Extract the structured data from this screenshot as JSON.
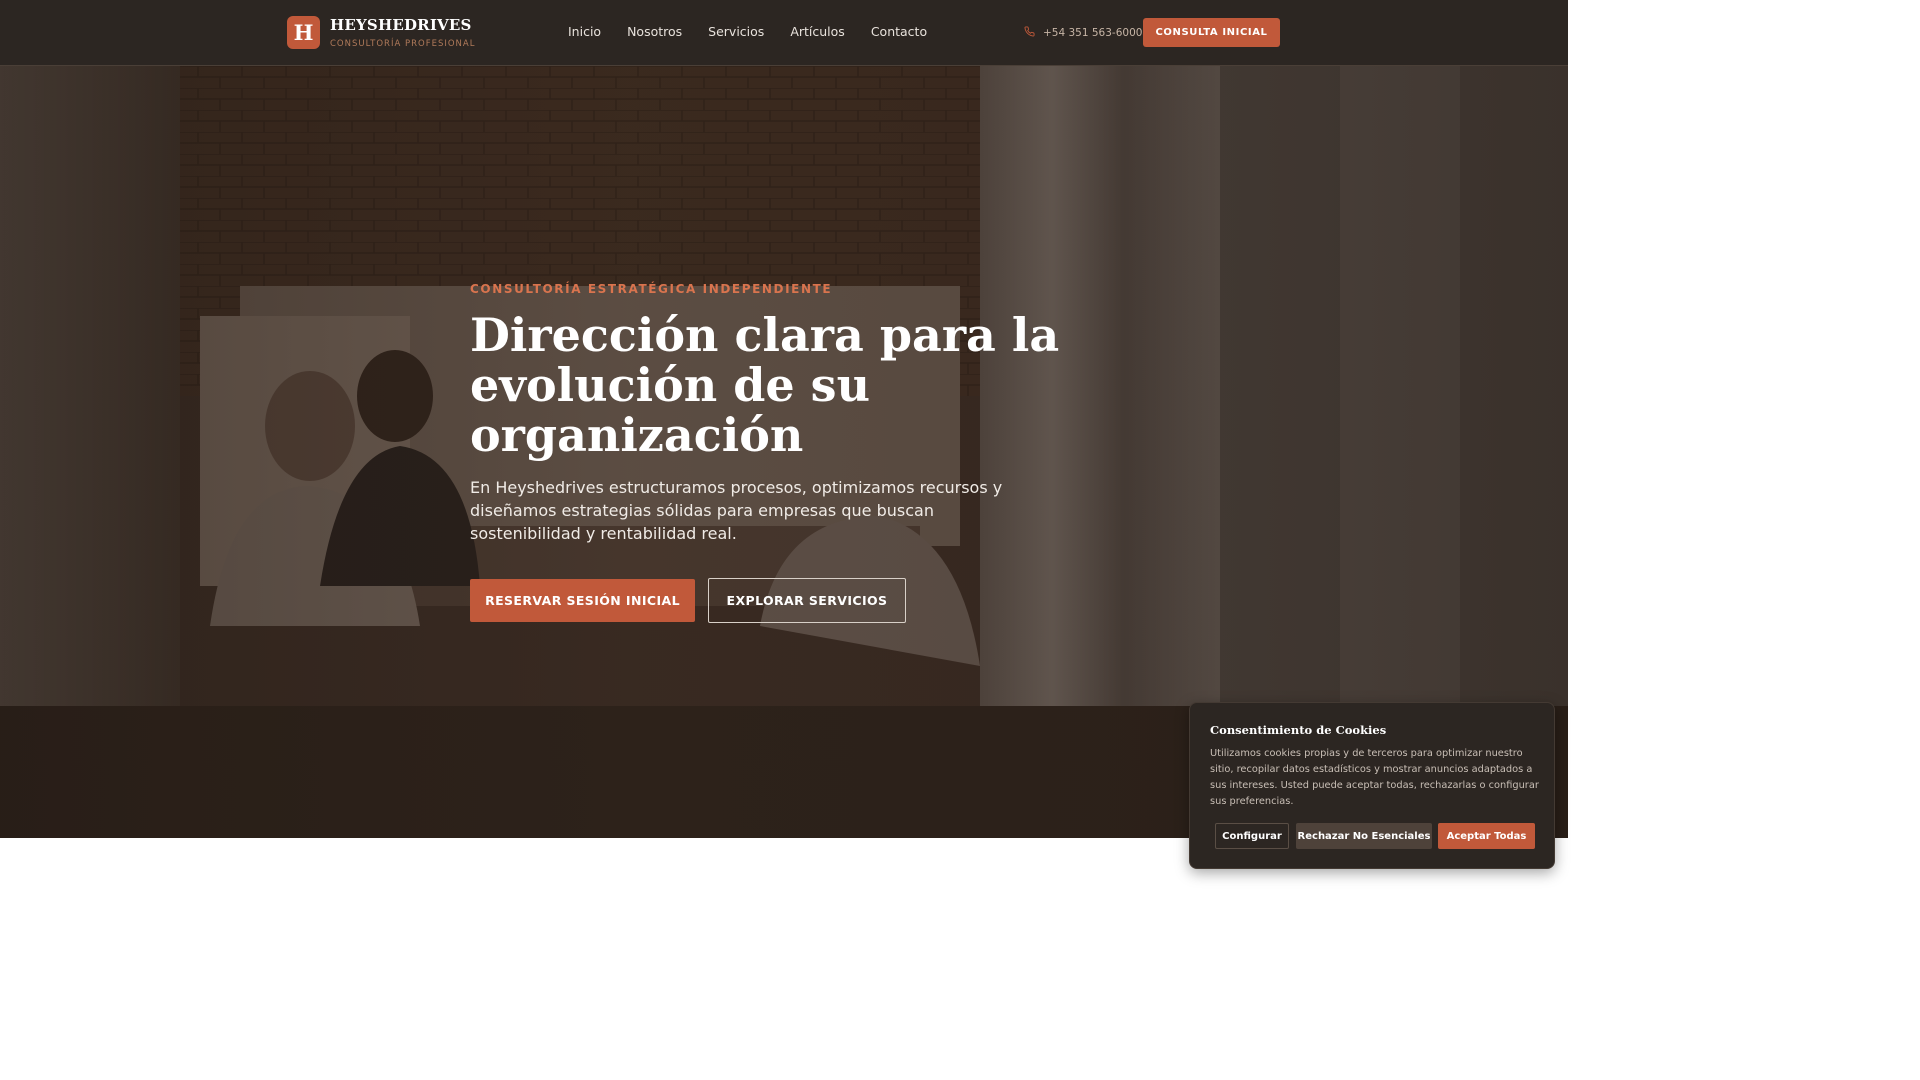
{
  "header": {
    "logo_letter": "H",
    "brand_name": "HEYSHEDRIVES",
    "brand_subtitle": "CONSULTORÍA PROFESIONAL",
    "nav": [
      "Inicio",
      "Nosotros",
      "Servicios",
      "Artículos",
      "Contacto"
    ],
    "phone": "+54 351 563-6000",
    "phone_icon": "phone-icon",
    "cta_label": "CONSULTA INICIAL"
  },
  "hero": {
    "eyebrow": "CONSULTORÍA ESTRATÉGICA INDEPENDIENTE",
    "headline_lines": [
      "Dirección clara para la",
      "evolución de su",
      "organización"
    ],
    "lead": "En Heyshedrives estructuramos procesos, optimizamos recursos y diseñamos estrategias sólidas para empresas que buscan sostenibilidad y rentabilidad real.",
    "primary_button": "RESERVAR SESIÓN INICIAL",
    "secondary_button": "EXPLORAR SERVICIOS"
  },
  "cookie": {
    "title": "Consentimiento de Cookies",
    "text": "Utilizamos cookies propias y de terceros para optimizar nuestro sitio, recopilar datos estadísticos y mostrar anuncios adaptados a sus intereses. Usted puede aceptar todas, rechazarlas o configurar sus preferencias.",
    "configure": "Configurar",
    "reject": "Rechazar No Esenciales",
    "accept": "Aceptar Todas"
  },
  "colors": {
    "header_bg": "#2c2622",
    "accent": "#c1593a",
    "eyebrow": "#d9744e"
  }
}
